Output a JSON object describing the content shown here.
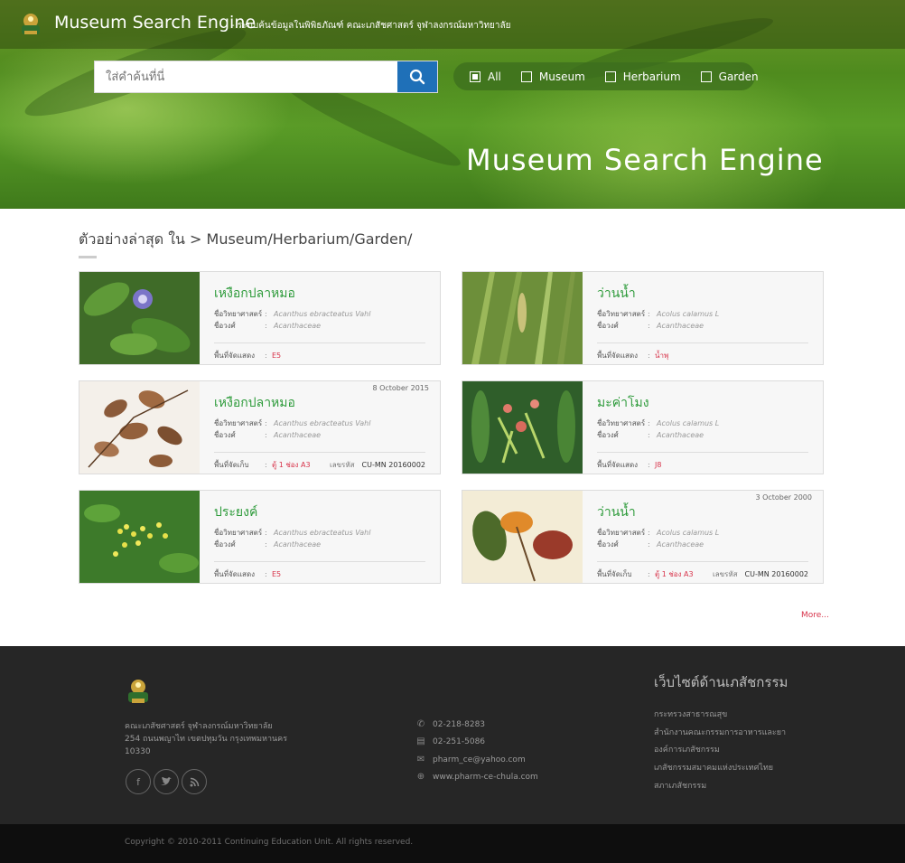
{
  "header": {
    "title": "Museum Search Engine",
    "subtitle": "- ระบบค้นข้อมูลในพิพิธภัณฑ์ คณะเภสัชศาสตร์ จุฬาลงกรณ์มหาวิทยาลัย",
    "hero_title": "Museum Search Engine"
  },
  "search": {
    "placeholder": "ใส่คำค้นที่นี่",
    "filters": [
      {
        "label": "All",
        "checked": true
      },
      {
        "label": "Museum",
        "checked": false
      },
      {
        "label": "Herbarium",
        "checked": false
      },
      {
        "label": "Garden",
        "checked": false
      }
    ]
  },
  "breadcrumb": "ตัวอย่างล่าสุด ใน  >  Museum/Herbarium/Garden/",
  "labels": {
    "sci_name": "ชื่อวิทยาศาสตร์",
    "family": "ชื่อวงศ์",
    "area": "พื้นที่จัดแสดง",
    "storage": "พื้นที่จัดเก็บ",
    "code": "เลขรหัส",
    "colon": ":"
  },
  "cards": [
    {
      "name": "เหงือกปลาหมอ",
      "date": "",
      "sci": "Acanthus ebracteatus Vahl",
      "family": "Acanthaceae",
      "loc_label": "พื้นที่จัดแสดง",
      "loc": "E5",
      "code": ""
    },
    {
      "name": "ว่านน้ำ",
      "date": "",
      "sci": "Acolus calamus L",
      "family": "Acanthaceae",
      "loc_label": "พื้นที่จัดแสดง",
      "loc": "น้ำพุ",
      "code": ""
    },
    {
      "name": "เหงือกปลาหมอ",
      "date": "8 October 2015",
      "sci": "Acanthus ebracteatus Vahl",
      "family": "Acanthaceae",
      "loc_label": "พื้นที่จัดเก็บ",
      "loc": "ตู้ 1 ช่อง A3",
      "code": "CU-MN 20160002"
    },
    {
      "name": "มะค่าโมง",
      "date": "",
      "sci": "Acolus calamus L",
      "family": "Acanthaceae",
      "loc_label": "พื้นที่จัดแสดง",
      "loc": "J8",
      "code": ""
    },
    {
      "name": "ประยงค์",
      "date": "",
      "sci": "Acanthus ebracteatus Vahl",
      "family": "Acanthaceae",
      "loc_label": "พื้นที่จัดแสดง",
      "loc": "E5",
      "code": ""
    },
    {
      "name": "ว่านน้ำ",
      "date": "3 October  2000",
      "sci": "Acolus calamus L",
      "family": "Acanthaceae",
      "loc_label": "พื้นที่จัดเก็บ",
      "loc": "ตู้ 1 ช่อง A3",
      "code": "CU-MN 20160002"
    }
  ],
  "more": "More...",
  "footer": {
    "address_line1": "คณะเภสัชศาสตร์ จุฬาลงกรณ์มหาวิทยาลัย",
    "address_line2": "254 ถนนพญาไท เขตปทุมวัน กรุงเทพมหานคร",
    "address_line3": "10330",
    "phone": "02-218-8283",
    "fax": "02-251-5086",
    "email": "pharm_ce@yahoo.com",
    "website": "www.pharm-ce-chula.com",
    "links_title": "เว็บไซต์ด้านเภสัชกรรม",
    "links": [
      "กระทรวงสาธารณสุข",
      "สำนักงานคณะกรรมการอาหารและยา",
      "องค์การเภสัชกรรม",
      "เภสัชกรรมสมาคมแห่งประเทศไทย",
      "สภาเภสัชกรรม"
    ],
    "copyright": "Copyright © 2010-2011 Continuing Education Unit. All rights reserved."
  }
}
